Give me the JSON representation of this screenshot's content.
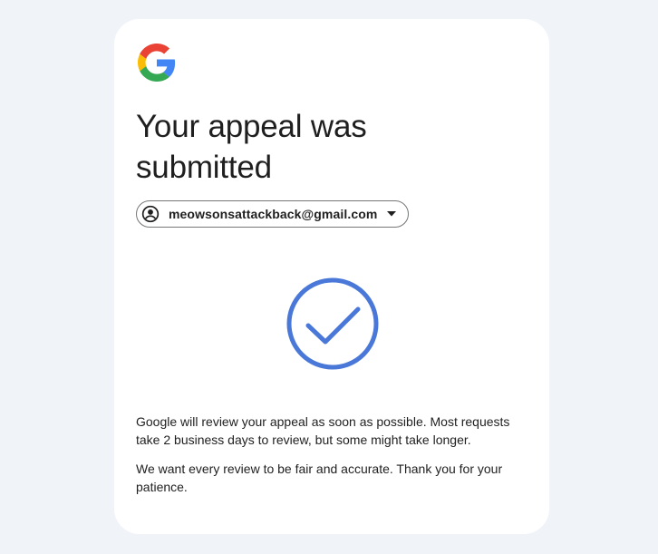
{
  "page": {
    "title": "Your appeal was submitted"
  },
  "account": {
    "email": "meowsonsattackback@gmail.com",
    "avatar_icon": "account-circle-icon",
    "dropdown_icon": "arrow-drop-down-icon"
  },
  "status": {
    "icon": "check-circle-icon",
    "color": "#4a78d9"
  },
  "messages": {
    "review_info": "Google will review your appeal as soon as possible. Most requests take 2 business days to review, but some might take longer.",
    "thanks": "We want every review to be fair and accurate. Thank you for your patience."
  },
  "brand": {
    "logo_icon": "google-g-logo",
    "colors": {
      "blue": "#4285F4",
      "red": "#EA4335",
      "yellow": "#FBBC05",
      "green": "#34A853"
    }
  }
}
